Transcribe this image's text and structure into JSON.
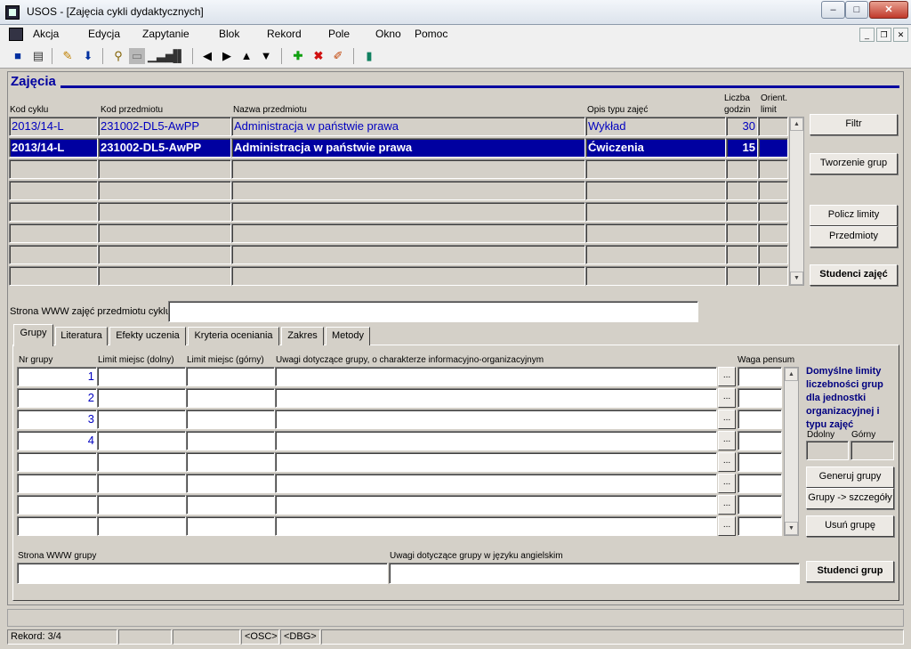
{
  "window": {
    "title": "USOS - [Zajęcia cykli dydaktycznych]"
  },
  "menu": [
    "Akcja",
    "Edycja",
    "Zapytanie",
    "Blok",
    "Rekord",
    "Pole",
    "Okno",
    "Pomoc"
  ],
  "toolbar_icons": [
    "save-icon",
    "print-icon",
    "edit-icon",
    "download-icon",
    "query-icon",
    "query-execute-icon",
    "chart-icon",
    "chart-bars-icon",
    "prev-icon",
    "next-icon",
    "up-icon",
    "down-icon",
    "insert-record-icon",
    "delete-record-icon",
    "clear-icon",
    "exit-icon"
  ],
  "heading": "Zajęcia",
  "columns": {
    "kod_cyklu": "Kod cyklu",
    "kod_przedmiotu": "Kod przedmiotu",
    "nazwa": "Nazwa przedmiotu",
    "opis_typu": "Opis typu zajęć",
    "liczba_godzin": "Liczba godzin",
    "orient_limit": "Orient. limit"
  },
  "rows": [
    {
      "kod_cyklu": "2013/14-L",
      "kod_przedmiotu": "231002-DL5-AwPP",
      "nazwa": "Administracja w państwie prawa",
      "opis_typu": "Wykład",
      "liczba_godzin": "30",
      "orient_limit": ""
    },
    {
      "kod_cyklu": "2013/14-L",
      "kod_przedmiotu": "231002-DL5-AwPP",
      "nazwa": "Administracja w państwie prawa",
      "opis_typu": "Ćwiczenia",
      "liczba_godzin": "15",
      "orient_limit": ""
    }
  ],
  "right_buttons": {
    "filtr": "Filtr",
    "tworzenie": "Tworzenie grup",
    "policz": "Policz limity",
    "przedmioty": "Przedmioty",
    "studenci_zajec": "Studenci zajęć"
  },
  "www_label": "Strona WWW zajęć przedmiotu cyklu",
  "www_value": "",
  "tabs": [
    "Grupy",
    "Literatura",
    "Efekty uczenia",
    "Kryteria oceniania",
    "Zakres",
    "Metody"
  ],
  "groups": {
    "col_nr": "Nr grupy",
    "col_limit_dolny": "Limit miejsc (dolny)",
    "col_limit_gorny": "Limit miejsc (górny)",
    "col_uwagi": "Uwagi dotyczące grupy, o charakterze informacyjno-organizacyjnym",
    "col_waga": "Waga pensum",
    "rows": [
      "1",
      "2",
      "3",
      "4",
      "",
      "",
      "",
      ""
    ],
    "ellipsis": "...",
    "side_title": "Domyślne limity liczebności grup dla jednostki organizacyjnej i typu zajęć",
    "dolny": "Ddolny",
    "gorny": "Górny",
    "btn_generuj": "Generuj grupy",
    "btn_szczegoly": "Grupy -> szczegóły",
    "btn_usun": "Usuń grupę",
    "www_grupy_label": "Strona WWW grupy",
    "uwagi_en_label": "Uwagi dotyczące grupy w języku angielskim",
    "btn_studenci_grup": "Studenci grup"
  },
  "status": {
    "rekord": "Rekord: 3/4",
    "osc": "<OSC>",
    "dbg": "<DBG>"
  }
}
